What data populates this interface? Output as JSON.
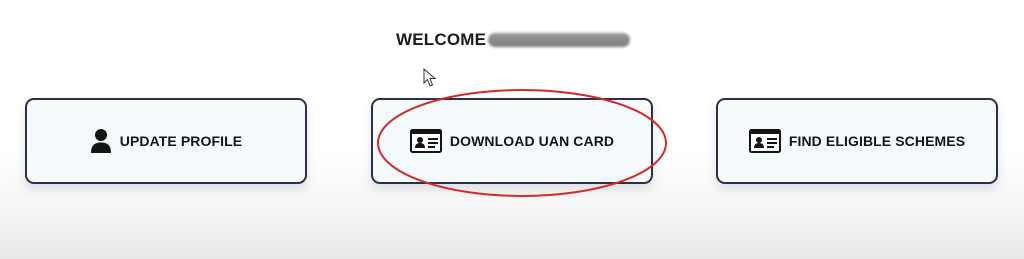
{
  "welcome": {
    "text": "WELCOME"
  },
  "cards": [
    {
      "label": "UPDATE PROFILE",
      "icon": "user-icon"
    },
    {
      "label": "DOWNLOAD UAN CARD",
      "icon": "id-card-icon"
    },
    {
      "label": "FIND ELIGIBLE SCHEMES",
      "icon": "id-card-icon"
    }
  ],
  "colors": {
    "card_border": "#2d2f4a",
    "card_background": "#f5fbfd",
    "highlight_annotation": "#d42a2a",
    "text": "#141414"
  }
}
